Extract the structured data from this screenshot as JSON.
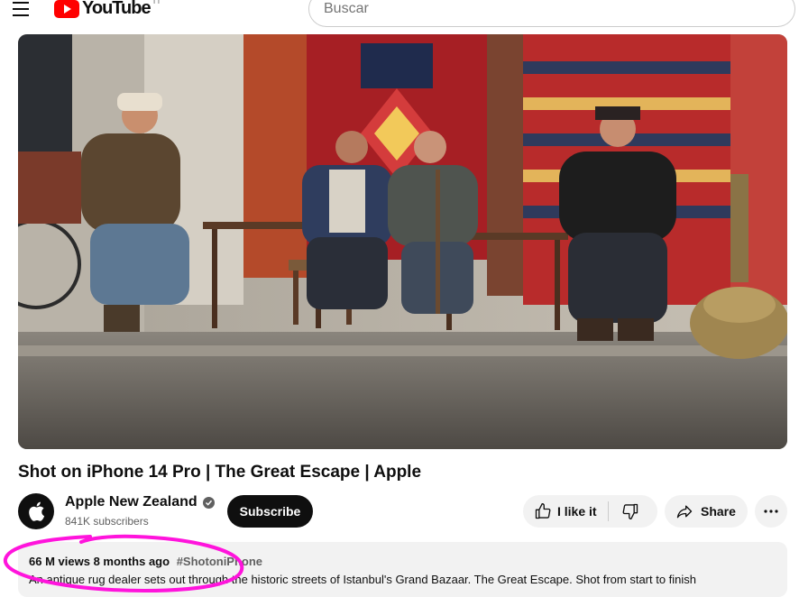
{
  "header": {
    "logo_text": "YouTube",
    "region_code": "TT",
    "search_placeholder": "Buscar"
  },
  "video": {
    "title": "Shot on iPhone 14 Pro | The Great Escape | Apple"
  },
  "channel": {
    "name": "Apple New Zealand",
    "subscribers": "841K subscribers",
    "subscribe_label": "Subscribe"
  },
  "actions": {
    "like_label": "I like it",
    "share_label": "Share"
  },
  "description": {
    "views": "66 M views",
    "age": "8 months ago",
    "hashtag": "#ShotoniPhone",
    "text": "An antique rug dealer sets out through the historic streets of Istanbul's Grand Bazaar. The Great Escape. Shot from start to finish"
  },
  "colors": {
    "brand_red": "#ff0000",
    "annotation_magenta": "#ff14dc",
    "button_bg": "#f2f2f2",
    "subscribe_bg": "#0f0f0f"
  },
  "icons": [
    "menu-icon",
    "youtube-logo-icon",
    "apple-logo-icon",
    "verified-icon",
    "thumbs-up-icon",
    "thumbs-down-icon",
    "share-icon",
    "more-icon"
  ]
}
